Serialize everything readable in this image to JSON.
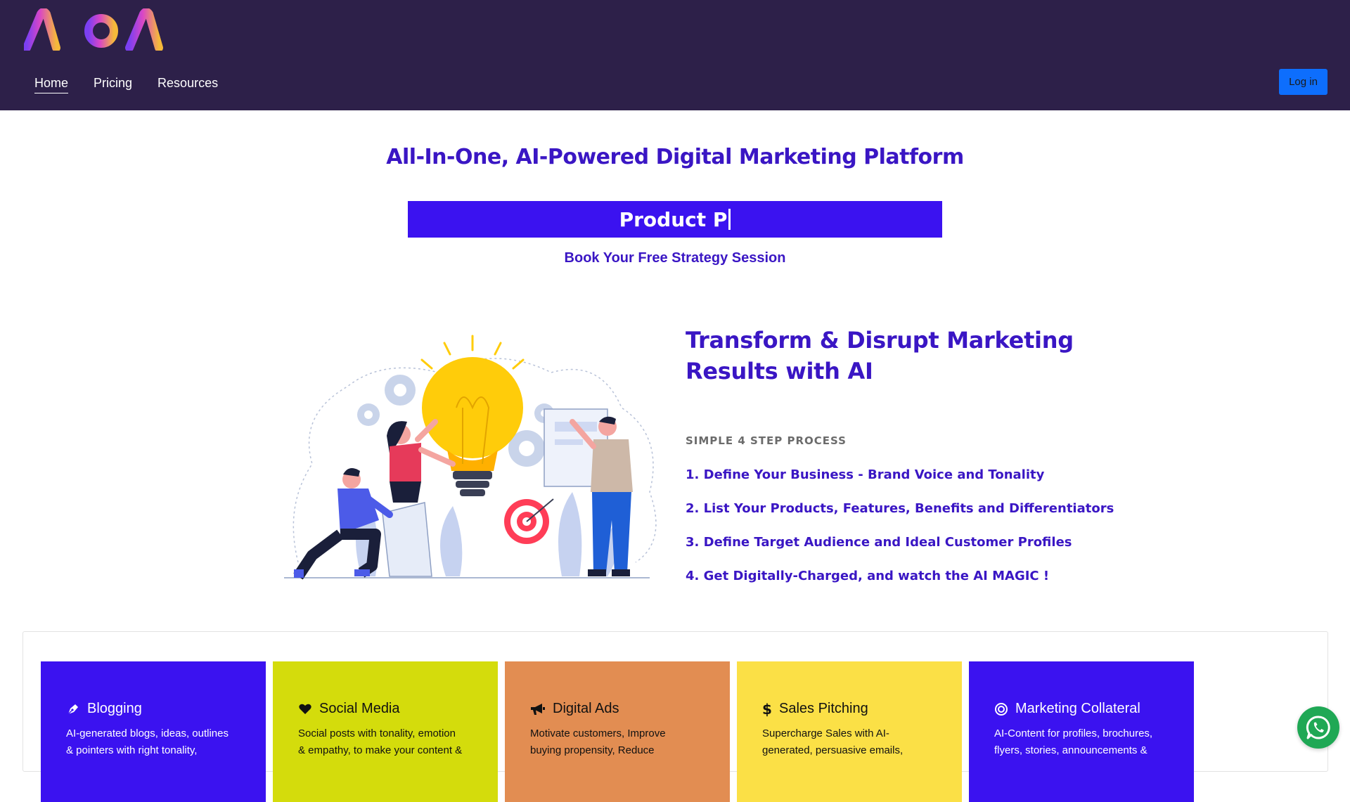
{
  "header": {
    "logo_text": "AIOAI",
    "nav": [
      {
        "label": "Home",
        "active": true
      },
      {
        "label": "Pricing",
        "active": false
      },
      {
        "label": "Resources",
        "active": false
      }
    ],
    "login_label": "Log in"
  },
  "hero": {
    "title": "All-In-One, AI-Powered Digital Marketing Platform",
    "typing_text": "Product P",
    "cta": "Book Your Free Strategy Session"
  },
  "process": {
    "title_line1": "Transform & Disrupt Marketing",
    "title_line2": "Results with AI",
    "subtitle": "SIMPLE 4 STEP PROCESS",
    "steps": [
      "1. Define Your Business - Brand Voice and Tonality",
      "2. List Your Products, Features, Benefits and Differentiators",
      "3. Define Target Audience and Ideal Customer Profiles",
      "4. Get Digitally-Charged, and watch the AI MAGIC !"
    ]
  },
  "cards": [
    {
      "title": "Blogging",
      "icon": "pen-nib-icon",
      "bg": "#3b12f0",
      "fg": "#ffffff",
      "desc_line1": "AI-generated blogs, ideas, outlines",
      "desc_line2": "& pointers with right tonality,"
    },
    {
      "title": "Social Media",
      "icon": "heart-icon",
      "bg": "#d4dc0c",
      "fg": "#111111",
      "desc_line1": "Social posts with tonality, emotion",
      "desc_line2": "& empathy, to make your content &"
    },
    {
      "title": "Digital Ads",
      "icon": "bullhorn-icon",
      "bg": "#e28d52",
      "fg": "#111111",
      "desc_line1": "Motivate customers, Improve",
      "desc_line2": "buying propensity, Reduce"
    },
    {
      "title": "Sales Pitching",
      "icon": "dollar-icon",
      "bg": "#fbe046",
      "fg": "#111111",
      "desc_line1": "Supercharge Sales with AI-",
      "desc_line2": "generated, persuasive emails,"
    },
    {
      "title": "Marketing Collateral",
      "icon": "bullseye-icon",
      "bg": "#3b12f0",
      "fg": "#ffffff",
      "desc_line1": "AI-Content for profiles, brochures,",
      "desc_line2": "flyers, stories, announcements &"
    }
  ],
  "colors": {
    "header_bg": "#2d2049",
    "brand_blue": "#3a16c4",
    "banner_blue": "#3b12f0",
    "login_blue": "#0d6efd",
    "whatsapp_green": "#1fa855"
  }
}
